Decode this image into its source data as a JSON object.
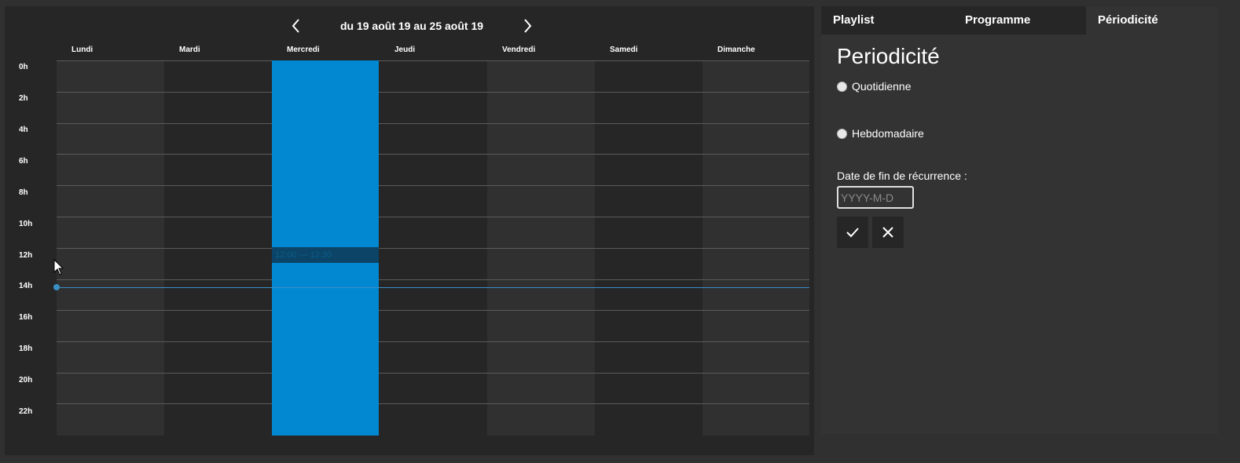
{
  "calendar": {
    "week_range": "du 19 août 19 au 25 août 19",
    "prev_icon": "chevron-left-icon",
    "next_icon": "chevron-right-icon",
    "days": [
      {
        "label": "Lundi"
      },
      {
        "label": "Mardi"
      },
      {
        "label": "Mercredi"
      },
      {
        "label": "Jeudi"
      },
      {
        "label": "Vendredi"
      },
      {
        "label": "Samedi"
      },
      {
        "label": "Dimanche"
      }
    ],
    "hours": [
      "0h",
      "2h",
      "4h",
      "6h",
      "8h",
      "10h",
      "12h",
      "14h",
      "16h",
      "18h",
      "20h",
      "22h"
    ],
    "selected_slot_label": "12:00 — 12:30",
    "event_color": "#0288d1",
    "now_line_color": "#3a8fc4"
  },
  "tabs": [
    {
      "label": "Playlist"
    },
    {
      "label": "Programme"
    },
    {
      "label": "Périodicité",
      "active": true
    }
  ],
  "periodicity": {
    "title": "Periodicité",
    "options": [
      {
        "label": "Quotidienne",
        "checked": false
      },
      {
        "label": "Hebdomadaire",
        "checked": false
      }
    ],
    "end_date_label": "Date de fin de récurrence :",
    "end_date_value": "",
    "end_date_placeholder": "YYYY-M-D",
    "confirm_icon": "check-icon",
    "cancel_icon": "close-icon"
  }
}
